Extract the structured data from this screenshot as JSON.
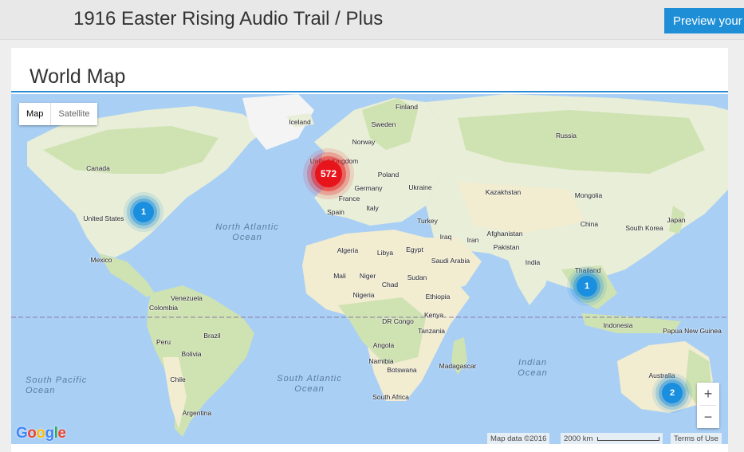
{
  "header": {
    "title": "1916 Easter Rising Audio Trail / Plus",
    "preview_button": "Preview your"
  },
  "panel": {
    "title": "World Map"
  },
  "map": {
    "type_control": {
      "map": "Map",
      "satellite": "Satellite",
      "selected": "Map"
    },
    "zoom": {
      "in": "+",
      "out": "−"
    },
    "attribution": {
      "map_data": "Map data ©2016",
      "scale": "2000 km",
      "terms": "Terms of Use"
    },
    "logo": "Google",
    "logo_letters": [
      "G",
      "o",
      "o",
      "g",
      "l",
      "e"
    ],
    "colors": {
      "water": "#a9cff5",
      "land": "#e8eed7",
      "desert": "#f2ecd0",
      "forest": "#cfe2b1",
      "cluster_blue": "#1a8fe0",
      "cluster_red": "#e8141b",
      "accent": "#1e8fd6"
    },
    "clusters": [
      {
        "name": "cluster-united-states",
        "count": "1",
        "color": "blue"
      },
      {
        "name": "cluster-europe",
        "count": "572",
        "color": "red"
      },
      {
        "name": "cluster-thailand",
        "count": "1",
        "color": "blue"
      },
      {
        "name": "cluster-australia",
        "count": "2",
        "color": "blue"
      }
    ],
    "countries": [
      "Finland",
      "Iceland",
      "Sweden",
      "Norway",
      "Russia",
      "Canada",
      "United Kingdom",
      "Poland",
      "Germany",
      "Ukraine",
      "Kazakhstan",
      "Mongolia",
      "France",
      "Italy",
      "Spain",
      "United States",
      "Turkey",
      "China",
      "Japan",
      "South Korea",
      "Iraq",
      "Iran",
      "Afghanistan",
      "Pakistan",
      "Algeria",
      "Libya",
      "Egypt",
      "Saudi Arabia",
      "India",
      "Mexico",
      "Mali",
      "Niger",
      "Chad",
      "Sudan",
      "Thailand",
      "Venezuela",
      "Nigeria",
      "Ethiopia",
      "Colombia",
      "Kenya",
      "DR Congo",
      "Tanzania",
      "Indonesia",
      "Papua New Guinea",
      "Peru",
      "Brazil",
      "Angola",
      "Bolivia",
      "Namibia",
      "Botswana",
      "Madagascar",
      "Chile",
      "South Africa",
      "Australia",
      "Argentina"
    ],
    "oceans": [
      "North Atlantic Ocean",
      "South Atlantic Ocean",
      "Indian Ocean",
      "South Pacific Ocean"
    ]
  }
}
